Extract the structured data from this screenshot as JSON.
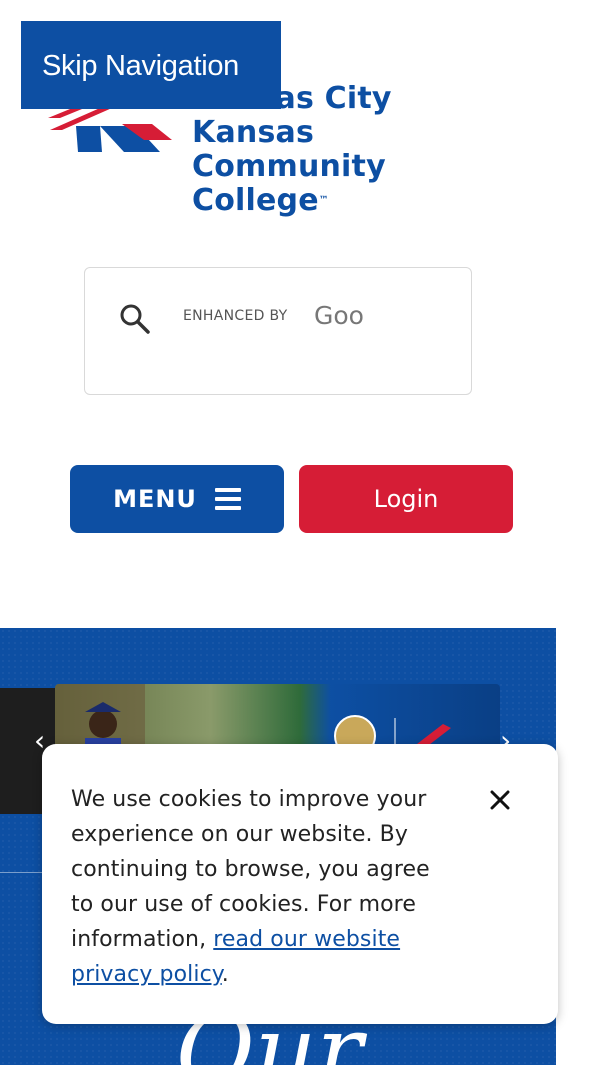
{
  "skip_nav": {
    "label": "Skip Navigation"
  },
  "logo": {
    "line1": "Kansas City Kansas",
    "line2": "Community College",
    "tm": "™"
  },
  "search": {
    "enhanced_label": "ENHANCED BY",
    "brand_partial": "Goo"
  },
  "buttons": {
    "menu_label": "MENU",
    "login_label": "Login"
  },
  "hero": {
    "script_text": "Our"
  },
  "cookie": {
    "message": "We use cookies to improve your experience on our website. By continuing to browse, you agree to our use of cookies. For more information, ",
    "link_text": "read our website privacy policy",
    "link_suffix": "."
  },
  "colors": {
    "brand_blue": "#0d4fa3",
    "brand_red": "#d61d36"
  },
  "icons": [
    "search-icon",
    "menu-icon",
    "close-icon",
    "chevron-left-icon",
    "chevron-right-icon"
  ]
}
